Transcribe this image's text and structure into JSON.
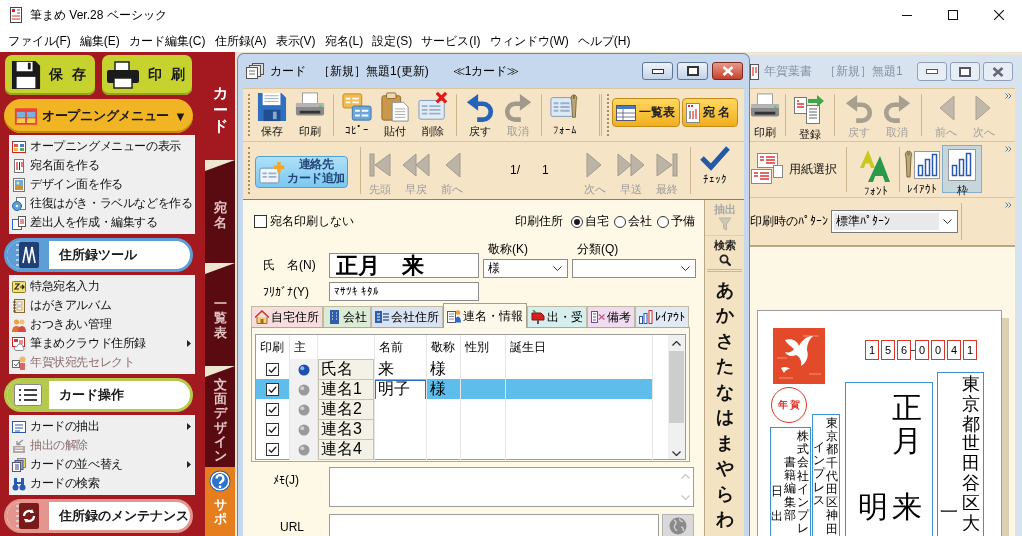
{
  "window": {
    "title": "筆まめ Ver.28 ベーシック"
  },
  "menu_bar": [
    "ファイル(F)",
    "編集(E)",
    "カード編集(C)",
    "住所録(A)",
    "表示(V)",
    "宛名(L)",
    "設定(S)",
    "サービス(I)",
    "ウィンドウ(W)",
    "ヘルプ(H)"
  ],
  "sidebar": {
    "buttons": [
      "保 存",
      "印 刷"
    ],
    "sections": [
      {
        "title": "オープニングメニュー",
        "kind": "dropdown",
        "arrow": "▼",
        "color": "#f1b424",
        "items": [
          {
            "label": "オープニングメニューの表示",
            "disabled": false,
            "submenu": false
          },
          {
            "label": "宛名面を作る",
            "disabled": false,
            "submenu": false
          },
          {
            "label": "デザイン面を作る",
            "disabled": false,
            "submenu": false
          },
          {
            "label": "往復はがき・ラベルなどを作る",
            "disabled": false,
            "submenu": false
          },
          {
            "label": "差出人を作成・編集する",
            "disabled": false,
            "submenu": false
          }
        ]
      },
      {
        "title": "住所録ツール",
        "kind": "panel",
        "color": "#5b9fd6",
        "items": [
          {
            "label": "特急宛名入力",
            "disabled": false,
            "submenu": false
          },
          {
            "label": "はがきアルバム",
            "disabled": false,
            "submenu": false
          },
          {
            "label": "おつきあい管理",
            "disabled": false,
            "submenu": false
          },
          {
            "label": "筆まめクラウド住所録",
            "disabled": false,
            "submenu": true
          },
          {
            "label": "年賀状宛先セレクト",
            "disabled": true,
            "submenu": false
          }
        ]
      },
      {
        "title": "カード操作",
        "kind": "panel",
        "color": "#b5c94c",
        "items": [
          {
            "label": "カードの抽出",
            "disabled": false,
            "submenu": true
          },
          {
            "label": "抽出の解除",
            "disabled": true,
            "submenu": false
          },
          {
            "label": "カードの並べ替え",
            "disabled": false,
            "submenu": true
          },
          {
            "label": "カードの検索",
            "disabled": false,
            "submenu": false
          }
        ]
      },
      {
        "title": "住所録のメンテナンス",
        "kind": "panel",
        "color": "#e4958d"
      }
    ]
  },
  "side_tabs": [
    {
      "label": "カード",
      "selected": true
    },
    {
      "label": "宛名",
      "selected": false
    },
    {
      "label": "一覧表",
      "selected": false
    },
    {
      "label": "文面デザイン",
      "selected": false
    }
  ],
  "support_tab": {
    "label": "サポ"
  },
  "card_window": {
    "title": "カード　［新規］無題1(更新)",
    "card_count": "≪1カード≫",
    "toolbar": [
      {
        "label": "保存",
        "disabled": false
      },
      {
        "label": "印刷",
        "disabled": false
      },
      {
        "label": "ｺﾋﾟｰ",
        "disabled": false
      },
      {
        "label": "貼付",
        "disabled": false
      },
      {
        "label": "削除",
        "disabled": false
      },
      {
        "label": "戻す",
        "disabled": false
      },
      {
        "label": "取消",
        "disabled": true
      },
      {
        "label": "ﾌｫｰﾑ",
        "disabled": false
      }
    ],
    "view_buttons": [
      "一覧表",
      "宛 名"
    ],
    "add_contact_button": [
      "連絡先",
      "カード追加"
    ],
    "navigation": [
      {
        "label": "先頭",
        "disabled": true
      },
      {
        "label": "早戻",
        "disabled": true
      },
      {
        "label": "前へ",
        "disabled": true
      },
      {
        "label": "次へ",
        "disabled": true
      },
      {
        "label": "早送",
        "disabled": true
      },
      {
        "label": "最終",
        "disabled": true
      }
    ],
    "page_position": "1/",
    "page_total": "1",
    "check_button": "ﾁｪｯｸ",
    "form": {
      "no_print": {
        "label": "宛名印刷しない",
        "checked": false
      },
      "print_address": {
        "label": "印刷住所",
        "options": [
          {
            "label": "自宅",
            "selected": true
          },
          {
            "label": "会社",
            "selected": false
          },
          {
            "label": "予備",
            "selected": false
          }
        ]
      },
      "name": {
        "label": "氏　名(N)",
        "value": "正月　来"
      },
      "honorific": {
        "label": "敬称(K)",
        "value": "様"
      },
      "category": {
        "label": "分類(Q)"
      },
      "furigana": {
        "label": "ﾌﾘｶﾞﾅ(Y)",
        "value": "ﾏｻﾂｷ ｷﾀﾙ"
      },
      "tabs": [
        {
          "label": "自宅住所",
          "selected": false,
          "color": "#f6dede"
        },
        {
          "label": "会社",
          "selected": false,
          "color": "#dcebd6"
        },
        {
          "label": "会社住所",
          "selected": false,
          "color": "#d9e3f1"
        },
        {
          "label": "連名・情報",
          "selected": true,
          "color": "#fcf8ea"
        },
        {
          "label": "出・受",
          "selected": false,
          "color": "#d6eeee"
        },
        {
          "label": "備考",
          "selected": false,
          "color": "#f0dcee"
        },
        {
          "label": "ﾚｲｱｳﾄ",
          "selected": false,
          "color": "#e1e9f3"
        }
      ],
      "joint_names": {
        "columns": [
          "印刷",
          "主",
          "名前",
          "敬称",
          "性別",
          "誕生日"
        ],
        "rows": [
          {
            "label": "氏名",
            "checked": true,
            "primary": true,
            "name": "来",
            "honorific": "様",
            "selected": false
          },
          {
            "label": "連名1",
            "checked": true,
            "primary": false,
            "name": "明子",
            "honorific": "様",
            "selected": true
          },
          {
            "label": "連名2",
            "checked": true,
            "primary": false,
            "selected": false
          },
          {
            "label": "連名3",
            "checked": true,
            "primary": false,
            "selected": false
          },
          {
            "label": "連名4",
            "checked": true,
            "primary": false,
            "selected": false
          }
        ]
      },
      "memo": {
        "label": "ﾒﾓ(J)"
      },
      "url": {
        "label": "URL"
      }
    },
    "index_strip": {
      "filter": {
        "label": "抽出",
        "disabled": true
      },
      "search": {
        "label": "検索"
      },
      "kana": [
        "あ",
        "か",
        "さ",
        "た",
        "な",
        "は",
        "ま",
        "や",
        "ら",
        "わ"
      ]
    }
  },
  "postcard_window": {
    "title": "年賀葉書　［新規］無題1",
    "toolbar": [
      {
        "label": "印刷",
        "disabled": false
      },
      {
        "label": "登録",
        "disabled": false
      },
      {
        "label": "戻す",
        "disabled": true
      },
      {
        "label": "取消",
        "disabled": true
      },
      {
        "label": "前へ",
        "disabled": true
      },
      {
        "label": "次へ",
        "disabled": true
      }
    ],
    "tools": [
      {
        "label": "用紙選択",
        "selected": false
      },
      {
        "label": "ﾌｫﾝﾄ",
        "selected": false
      },
      {
        "label": "ﾚｲｱｳﾄ",
        "selected": false
      },
      {
        "label": "枠",
        "selected": true
      }
    ],
    "print_pattern": {
      "label": "印刷時のﾊﾟﾀｰﾝ",
      "value": "標準ﾊﾟﾀｰﾝ"
    },
    "postcard": {
      "postal_code": [
        "1",
        "5",
        "6",
        "0",
        "0",
        "4",
        "1"
      ],
      "address": [
        "東京都世田谷区大",
        "一"
      ],
      "recipient": {
        "family_name": "正月",
        "joint_name": "明",
        "given_name": "来"
      },
      "new_year_mark": "年 賀",
      "sender_address": {
        "line_1": "東京都千代田区神田",
        "line_2": "インプレス"
      },
      "sender_name": {
        "company": "株式会社インプレ",
        "department": "書籍編集部",
        "person_name": [
          "日",
          "出"
        ]
      }
    }
  }
}
